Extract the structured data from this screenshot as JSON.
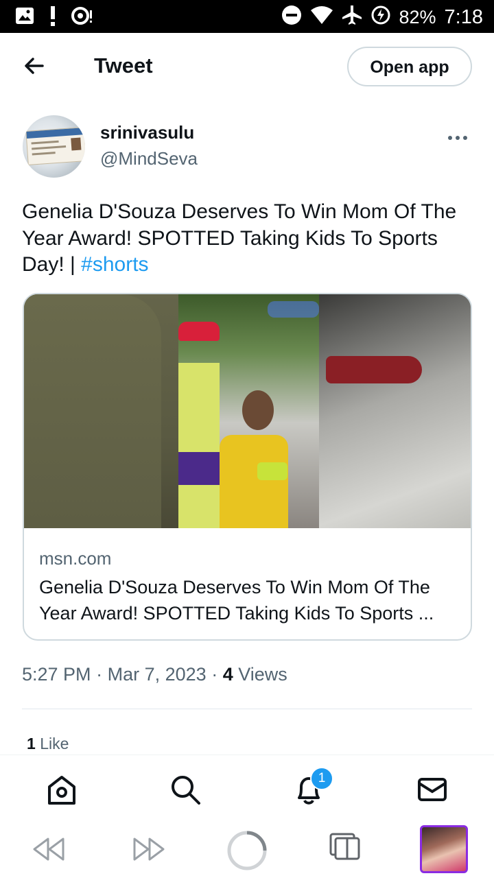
{
  "status_bar": {
    "battery": "82%",
    "time": "7:18",
    "icons": [
      "gallery-icon",
      "alert-icon",
      "sync-icon",
      "dnd-icon",
      "wifi-icon",
      "airplane-icon",
      "battery-saver-icon"
    ]
  },
  "header": {
    "title": "Tweet",
    "open_app_label": "Open app",
    "back_icon": "arrow-left-icon"
  },
  "tweet": {
    "author_name": "srinivasulu",
    "author_handle": "@MindSeva",
    "text_main": "Genelia D'Souza Deserves To Win Mom Of The Year Award! SPOTTED Taking Kids To Sports Day! | ",
    "hashtag": "#shorts",
    "more_icon": "more-dots-icon"
  },
  "link_card": {
    "domain": "msn.com",
    "title": "Genelia D'Souza Deserves To Win Mom Of The Year Award! SPOTTED Taking Kids To Sports ..."
  },
  "meta": {
    "time": "5:27 PM",
    "date": "Mar 7, 2023",
    "views_count": "4",
    "views_label": "Views"
  },
  "engagement": {
    "likes_count": "1",
    "likes_label": "Like"
  },
  "bottom_nav": {
    "items": [
      "home-icon",
      "search-icon",
      "notifications-icon",
      "messages-icon"
    ],
    "notification_badge": "1"
  },
  "colors": {
    "accent": "#1d9bf0",
    "secondary_text": "#536471",
    "primary_text": "#0f1419",
    "border": "#cfd9de"
  }
}
